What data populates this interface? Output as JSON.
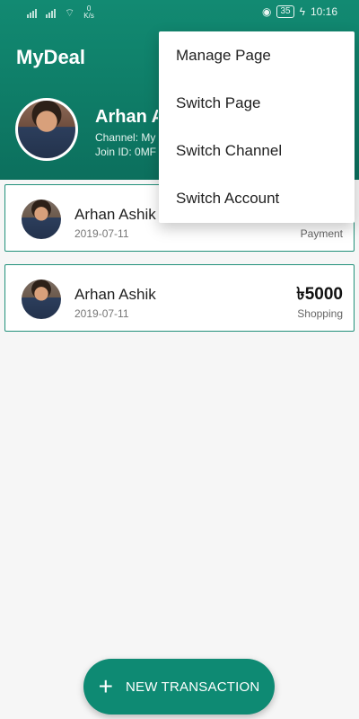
{
  "status_bar": {
    "network_speed_top": "0",
    "network_speed_unit": "K/s",
    "battery": "35",
    "time": "10:16"
  },
  "app": {
    "title": "MyDeal"
  },
  "profile": {
    "name": "Arhan A",
    "channel": "Channel: My",
    "join_id": "Join ID: 0MF"
  },
  "menu": {
    "items": [
      {
        "label": "Manage Page"
      },
      {
        "label": "Switch Page"
      },
      {
        "label": "Switch Channel"
      },
      {
        "label": "Switch Account"
      }
    ]
  },
  "transactions": [
    {
      "name": "Arhan Ashik",
      "date": "2019-07-11",
      "type": "Payment"
    },
    {
      "name": "Arhan Ashik",
      "date": "2019-07-11",
      "amount": "৳5000",
      "type": "Shopping"
    }
  ],
  "fab": {
    "icon": "plus-icon",
    "label": "NEW TRANSACTION"
  },
  "colors": {
    "primary": "#128a72",
    "card_border": "#22907a"
  }
}
